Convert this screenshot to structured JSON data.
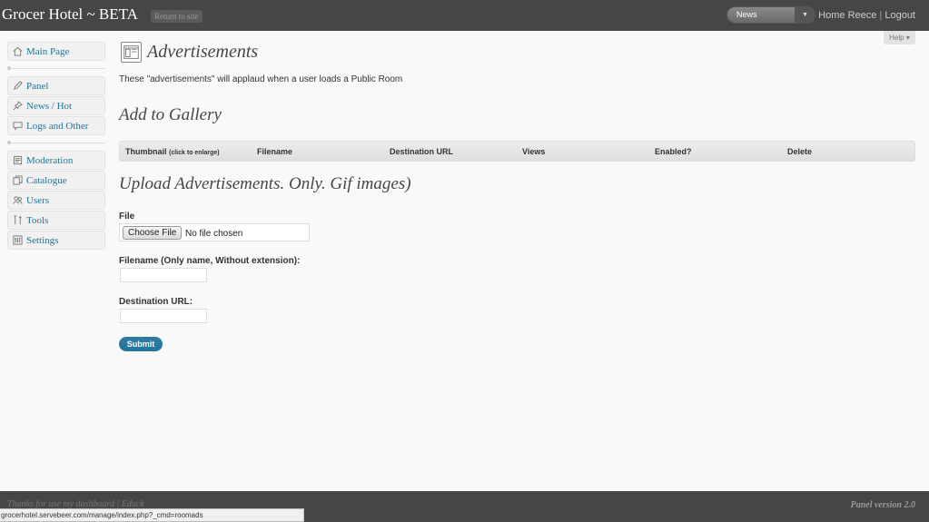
{
  "header": {
    "site_title": "Grocer Hotel ~ BETA",
    "return_label": "Return to site",
    "favorites_selected": "News",
    "home_label": "Home",
    "username": "Reece",
    "separator": "|",
    "logout_label": "Logout"
  },
  "help_label": "Help ▾",
  "sidebar": {
    "items": [
      {
        "label": "Main Page",
        "icon": "home-icon"
      },
      {
        "label": "Panel",
        "icon": "pen-icon"
      },
      {
        "label": "News / Hot",
        "icon": "pin-icon"
      },
      {
        "label": "Logs and Other",
        "icon": "comment-icon"
      },
      {
        "label": "Moderation",
        "icon": "page-icon"
      },
      {
        "label": "Catalogue",
        "icon": "copy-icon"
      },
      {
        "label": "Users",
        "icon": "users-icon"
      },
      {
        "label": "Tools",
        "icon": "tools-icon"
      },
      {
        "label": "Settings",
        "icon": "settings-icon"
      }
    ]
  },
  "main": {
    "title": "Advertisements",
    "intro": "These \"advertisements\" will applaud when a user loads a Public Room",
    "gallery_title": "Add to Gallery",
    "table_headers": {
      "thumbnail": "Thumbnail",
      "thumbnail_note": "(click to enlarge)",
      "filename": "Filename",
      "destination": "Destination URL",
      "views": "Views",
      "enabled": "Enabled?",
      "delete": "Delete"
    },
    "upload_title": "Upload Advertisements. Only. Gif images)",
    "file_label": "File",
    "choose_file": "Choose File",
    "no_file": "No file chosen",
    "filename_label": "Filename (Only name, Without extension):",
    "filename_value": "",
    "destination_label": "Destination URL:",
    "destination_value": "",
    "submit_label": "Submit"
  },
  "footer": {
    "left_text": "Thanks for use my dashboard | Educk",
    "right_text": "Panel version 2.0"
  },
  "status_bar": "grocerhotel.servebeer.com/manage/index.php?_cmd=roomads",
  "colors": {
    "header_bg": "#464646",
    "link": "#21759b",
    "button": "#21759b",
    "background": "#f9f9f9"
  }
}
